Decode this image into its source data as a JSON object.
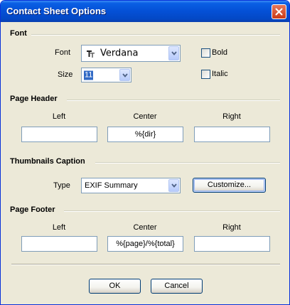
{
  "window": {
    "title": "Contact Sheet Options"
  },
  "font_section": {
    "heading": "Font",
    "font_label": "Font",
    "font_value": "Verdana",
    "size_label": "Size",
    "size_value": "11",
    "bold_label": "Bold",
    "italic_label": "Italic",
    "bold_checked": false,
    "italic_checked": false
  },
  "page_header": {
    "heading": "Page Header",
    "left_label": "Left",
    "center_label": "Center",
    "right_label": "Right",
    "left_value": "",
    "center_value": "%{dir}",
    "right_value": ""
  },
  "thumbnails_caption": {
    "heading": "Thumbnails Caption",
    "type_label": "Type",
    "type_value": "EXIF Summary",
    "customize_label": "Customize..."
  },
  "page_footer": {
    "heading": "Page Footer",
    "left_label": "Left",
    "center_label": "Center",
    "right_label": "Right",
    "left_value": "",
    "center_value": "%{page}/%{total}",
    "right_value": ""
  },
  "buttons": {
    "ok_label": "OK",
    "cancel_label": "Cancel"
  }
}
